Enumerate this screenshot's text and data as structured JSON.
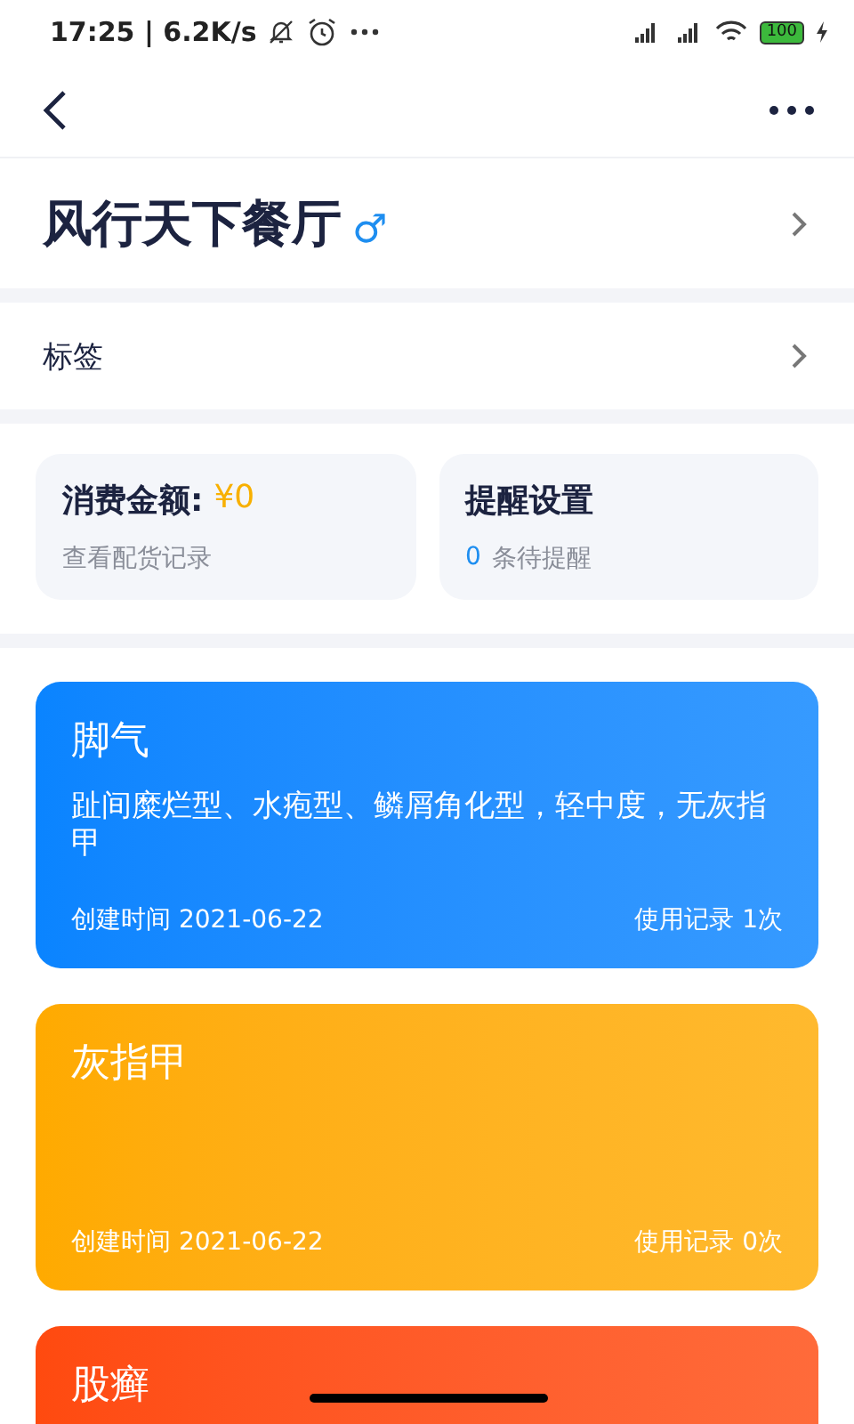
{
  "status_bar": {
    "time": "17:25 | 6.2K/s",
    "battery": "100"
  },
  "header": {
    "title": "风行天下餐厅",
    "gender_symbol": "♂"
  },
  "tag_row": {
    "label": "标签"
  },
  "summary": {
    "spend": {
      "label": "消费金额:",
      "value": "¥0",
      "link": "查看配货记录"
    },
    "reminder": {
      "label": "提醒设置",
      "count": "0",
      "text": "条待提醒"
    }
  },
  "cards": [
    {
      "title": "脚气",
      "description": "趾间糜烂型、水疱型、鳞屑角化型，轻中度，无灰指甲",
      "created": "创建时间 2021-06-22",
      "usage": "使用记录 1次",
      "color": "#0a84ff"
    },
    {
      "title": "灰指甲",
      "created": "创建时间 2021-06-22",
      "usage": "使用记录 0次",
      "color": "#ffaa00"
    },
    {
      "title": "股癣",
      "color": "#ff4a0f"
    }
  ]
}
